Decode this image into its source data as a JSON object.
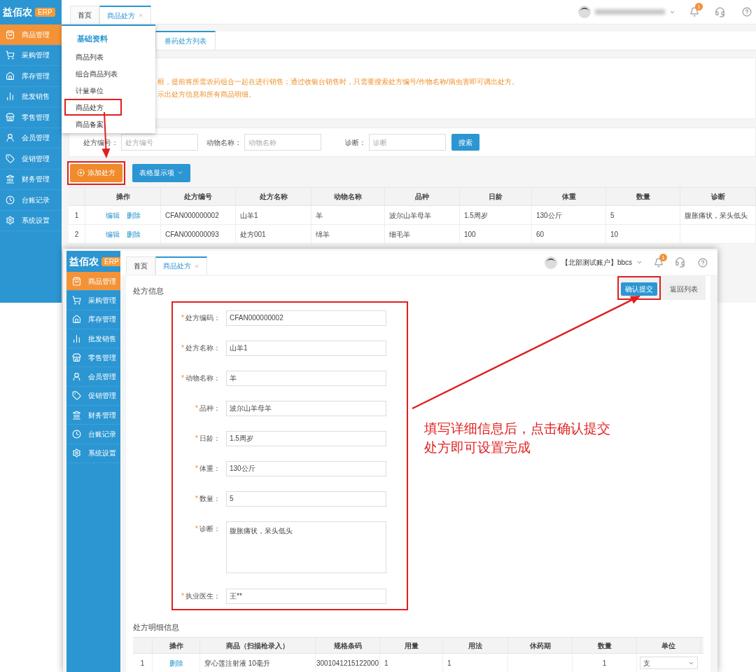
{
  "back_screen": {
    "logo": {
      "name": "益佰农",
      "badge": "ERP"
    },
    "sidebar": [
      {
        "label": "商品管理",
        "selected": true
      },
      {
        "label": "采购管理",
        "selected": false
      },
      {
        "label": "库存管理",
        "selected": false
      },
      {
        "label": "批发销售",
        "selected": false
      },
      {
        "label": "零售管理",
        "selected": false
      },
      {
        "label": "会员管理",
        "selected": false
      },
      {
        "label": "促销管理",
        "selected": false
      },
      {
        "label": "财务管理",
        "selected": false
      },
      {
        "label": "台账记录",
        "selected": false
      },
      {
        "label": "系统设置",
        "selected": false
      }
    ],
    "tabs": [
      {
        "label": "首页",
        "selected": false,
        "closable": false
      },
      {
        "label": "商品处方",
        "selected": true,
        "closable": true
      }
    ],
    "bell_badge": "1",
    "dropdown": {
      "heading": "基础资料",
      "items": [
        {
          "label": "商品列表",
          "annotated": false
        },
        {
          "label": "组合商品列表",
          "annotated": false
        },
        {
          "label": "计量单位",
          "annotated": false
        },
        {
          "label": "商品处方",
          "annotated": true
        },
        {
          "label": "商品备案",
          "annotated": false
        }
      ]
    },
    "page_tab": "兽药处方列表",
    "notice": [
      "框，提前将所需农药组合一起在进行销售；通过收银台销售时，只需要搜索处方编号/作物名称/病虫害即可调出处方。",
      "示出处方信息和所有商品明细。"
    ],
    "search": {
      "fields": [
        {
          "label": "处方编号：",
          "placeholder": "处方编号"
        },
        {
          "label": "动物名称：",
          "placeholder": "动物名称"
        },
        {
          "label": "诊断：",
          "placeholder": "诊断"
        }
      ],
      "button": "搜索"
    },
    "actions": [
      {
        "label": "添加处方",
        "kind": "add",
        "annotated": true
      },
      {
        "label": "表格显示项",
        "kind": "dropdown",
        "annotated": false
      }
    ],
    "table": {
      "columns": [
        "",
        "操作",
        "处方编号",
        "处方名称",
        "动物名称",
        "品种",
        "日龄",
        "体重",
        "数量",
        "诊断"
      ],
      "rows": [
        {
          "cells": [
            "1",
            {
              "links": [
                "编辑",
                "删除"
              ]
            },
            "CFAN000000002",
            "山羊1",
            "羊",
            "波尔山羊母羊",
            "1.5周岁",
            "130公斤",
            "5",
            "腹胀痛状，呆头低头"
          ]
        },
        {
          "cells": [
            "2",
            {
              "links": [
                "编辑",
                "删除"
              ]
            },
            "CFAN000000093",
            "处方001",
            "绵羊",
            "细毛羊",
            "100",
            "60",
            "10",
            ""
          ]
        }
      ]
    }
  },
  "front_screen": {
    "logo": {
      "name": "益佰农",
      "badge": "ERP"
    },
    "sidebar": [
      {
        "label": "商品管理",
        "selected": true
      },
      {
        "label": "采购管理",
        "selected": false
      },
      {
        "label": "库存管理",
        "selected": false
      },
      {
        "label": "批发销售",
        "selected": false
      },
      {
        "label": "零售管理",
        "selected": false
      },
      {
        "label": "会员管理",
        "selected": false
      },
      {
        "label": "促销管理",
        "selected": false
      },
      {
        "label": "财务管理",
        "selected": false
      },
      {
        "label": "台账记录",
        "selected": false
      },
      {
        "label": "系统设置",
        "selected": false
      }
    ],
    "tabs": [
      {
        "label": "首页",
        "selected": false,
        "closable": false
      },
      {
        "label": "商品处方",
        "selected": true,
        "closable": true
      }
    ],
    "account": "【北部测试账户】bbcs",
    "bell_badge": "1",
    "title": "处方信息",
    "buttons": [
      {
        "label": "确认提交",
        "kind": "primary",
        "annotated": true
      },
      {
        "label": "返回列表",
        "kind": "secondary",
        "annotated": false
      }
    ],
    "form": {
      "annotated": true,
      "fields": [
        {
          "mark": "*",
          "label": "处方编码：",
          "value": "CFAN000000002",
          "kind": "input"
        },
        {
          "mark": "*",
          "label": "处方名称：",
          "value": "山羊1",
          "kind": "input"
        },
        {
          "mark": "*",
          "label": "动物名称：",
          "value": "羊",
          "kind": "input"
        },
        {
          "mark": "*",
          "label": "品种：",
          "value": "波尔山羊母羊",
          "kind": "input"
        },
        {
          "mark": "*",
          "label": "日龄：",
          "value": "1.5周岁",
          "kind": "input"
        },
        {
          "mark": "*",
          "label": "体重：",
          "value": "130公斤",
          "kind": "input"
        },
        {
          "mark": "*",
          "label": "数量：",
          "value": "5",
          "kind": "input"
        },
        {
          "mark": "*",
          "label": "诊断：",
          "value": "腹胀痛状，呆头低头",
          "kind": "textarea"
        },
        {
          "mark": "*",
          "label": "执业医生：",
          "value": "王**",
          "kind": "input"
        }
      ]
    },
    "note": [
      "填写详细信息后，点击确认提交",
      "处方即可设置完成"
    ],
    "detail_title": "处方明细信息",
    "detail_table": {
      "columns": [
        "",
        "操作",
        "商品（扫描枪录入）",
        "规格条码",
        "用量",
        "用法",
        "休药期",
        "数量",
        "单位"
      ],
      "rows": [
        {
          "cells": [
            "1",
            {
              "links": [
                "删除"
              ]
            },
            "穿心莲注射液 10毫升",
            "3001041215122000",
            "1",
            "1",
            "",
            "1",
            {
              "select": "支"
            }
          ]
        }
      ]
    }
  }
}
